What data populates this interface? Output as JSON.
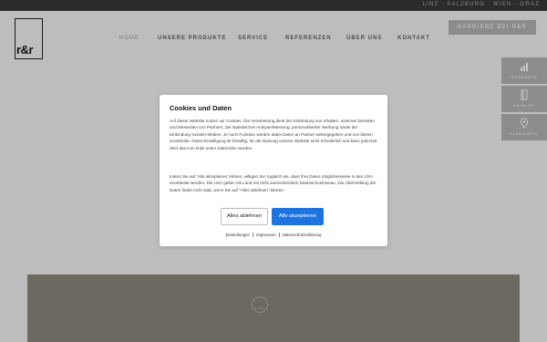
{
  "topbar": {
    "locations": "LINZ · SALZBURG · WIEN · GRAZ"
  },
  "logo": {
    "text": "r&r"
  },
  "nav": [
    {
      "label": "HOME"
    },
    {
      "label": "UNSERE PRODUKTE"
    },
    {
      "label": "SERVICE"
    },
    {
      "label": "REFERENZEN"
    },
    {
      "label": "ÜBER UNS"
    },
    {
      "label": "KONTAKT"
    }
  ],
  "career_button": "KARRIERE BEI R&R",
  "side_buttons": [
    {
      "label": "ANGEBOTE",
      "icon": "chart-icon"
    },
    {
      "label": "KATALOG",
      "icon": "catalog-icon"
    },
    {
      "label": "STANDORTE",
      "icon": "location-pin-icon"
    }
  ],
  "banner": {
    "label": "LINZ"
  },
  "cookie": {
    "title": "Cookies und Daten",
    "paragraph1": "Auf dieser Website nutzen wir Cookies. Die Verarbeitung dient der Einbindung von Inhalten, externen Diensten und Elementen von Partnern, der statistischen Analyse/Messung, personalisierter Werbung sowie der Einbindung sozialer Medien. Je nach Funktion werden dabei Daten an Partner weitergegeben und von diesen verarbeitet. Diese Einwilligung ist freiwillig, für die Nutzung unserer Website nicht erforderlich und kann jederzeit über das Icon links unten widerrufen werden.",
    "paragraph2": "Indem Sie auf 'Alle akzeptieren' klicken, willigen Sie zugleich ein, dass Ihre Daten möglicherweise in den USA verarbeitet werden. Die USA gelten als Land mit nicht ausreichendem Datenschutzniveau. Die Übermittlung der Daten findet nicht statt, wenn Sie auf \"Alles ablehnen\" klicken.",
    "decline_label": "Alles ablehnen",
    "accept_label": "Alle akzeptieren",
    "links": [
      "Einstellungen",
      "Impressum",
      "Datenschutzerklärung"
    ],
    "accent_color": "#1f73e0"
  }
}
